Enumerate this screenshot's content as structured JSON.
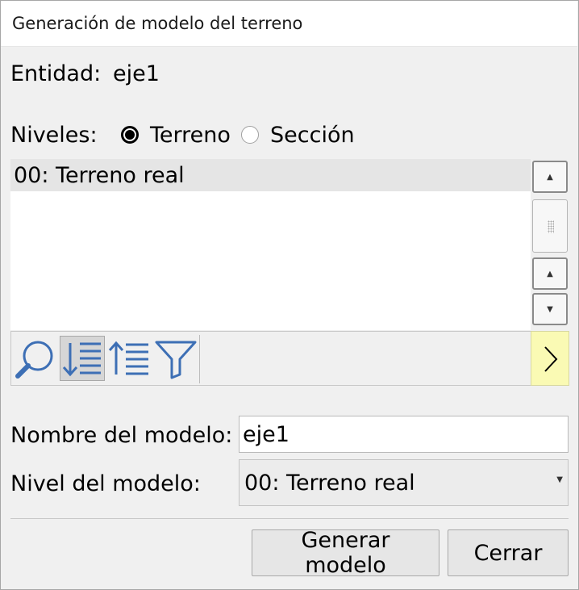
{
  "window": {
    "title": "Generación de modelo del terreno"
  },
  "entity": {
    "label": "Entidad:",
    "value": "eje1"
  },
  "levels": {
    "label": "Niveles:",
    "options": [
      {
        "label": "Terreno",
        "checked": true
      },
      {
        "label": "Sección",
        "checked": false
      }
    ]
  },
  "list": {
    "items": [
      "00: Terreno real"
    ]
  },
  "scrollbar": {
    "icons": [
      "scroll-up-arrow",
      "scroll-thumb",
      "scroll-up-arrow",
      "scroll-down-arrow"
    ]
  },
  "toolbar": {
    "icons": [
      "search-icon",
      "sort-descending-icon",
      "sort-ascending-icon",
      "filter-icon"
    ],
    "accent": "#3d6fb5",
    "expander_icon": "chevron-right-icon",
    "expander_color": "#fafab4"
  },
  "model_name": {
    "label": "Nombre del modelo:",
    "value": "eje1"
  },
  "model_level": {
    "label": "Nivel del modelo:",
    "value": "00: Terreno real"
  },
  "buttons": {
    "generate": "Generar modelo",
    "close": "Cerrar"
  }
}
